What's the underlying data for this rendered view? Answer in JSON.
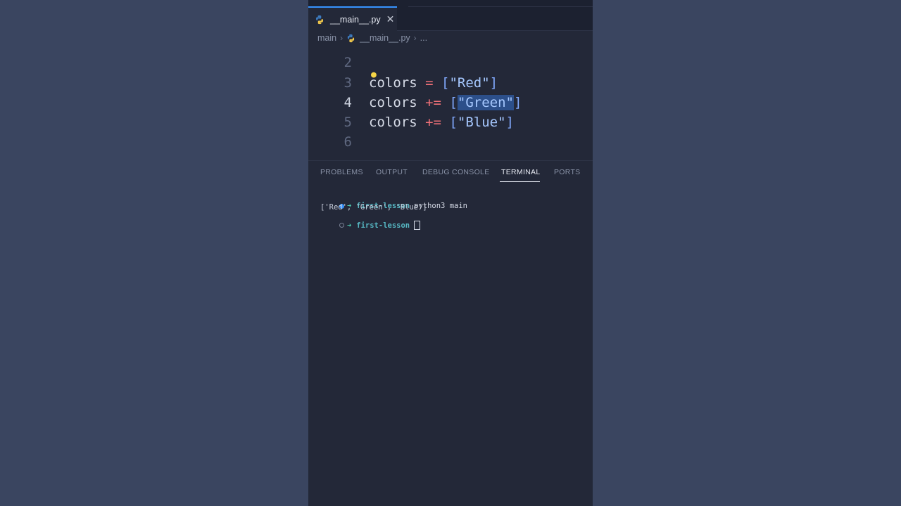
{
  "editor_tab": {
    "filename": "__main__.py",
    "close_glyph": "✕"
  },
  "breadcrumb": {
    "folder": "main",
    "file": "__main__.py",
    "ellipsis": "..."
  },
  "code": {
    "lines": [
      {
        "number": "2",
        "text": ""
      },
      {
        "number": "3",
        "var": "colors",
        "op": "=",
        "open": "[",
        "value": "\"Red\"",
        "close": "]"
      },
      {
        "number": "4",
        "var": "colors",
        "op": "+=",
        "open": "[",
        "value": "\"Green\"",
        "close": "]"
      },
      {
        "number": "5",
        "var": "colors",
        "op": "+=",
        "open": "[",
        "value": "\"Blue\"",
        "close": "]"
      },
      {
        "number": "6",
        "text": ""
      }
    ],
    "active_line": "4"
  },
  "panel": {
    "tabs": [
      "PROBLEMS",
      "OUTPUT",
      "DEBUG CONSOLE",
      "TERMINAL",
      "PORTS"
    ],
    "active_tab": "TERMINAL"
  },
  "terminal": {
    "prompt_arrow": "➜",
    "dir": "first-lesson",
    "command": "python3 main",
    "output": "['Red', 'Green', 'Blue']"
  },
  "colors": {
    "accent": "#3794ff",
    "background": "#3a4560",
    "editor_bg": "#232838"
  }
}
